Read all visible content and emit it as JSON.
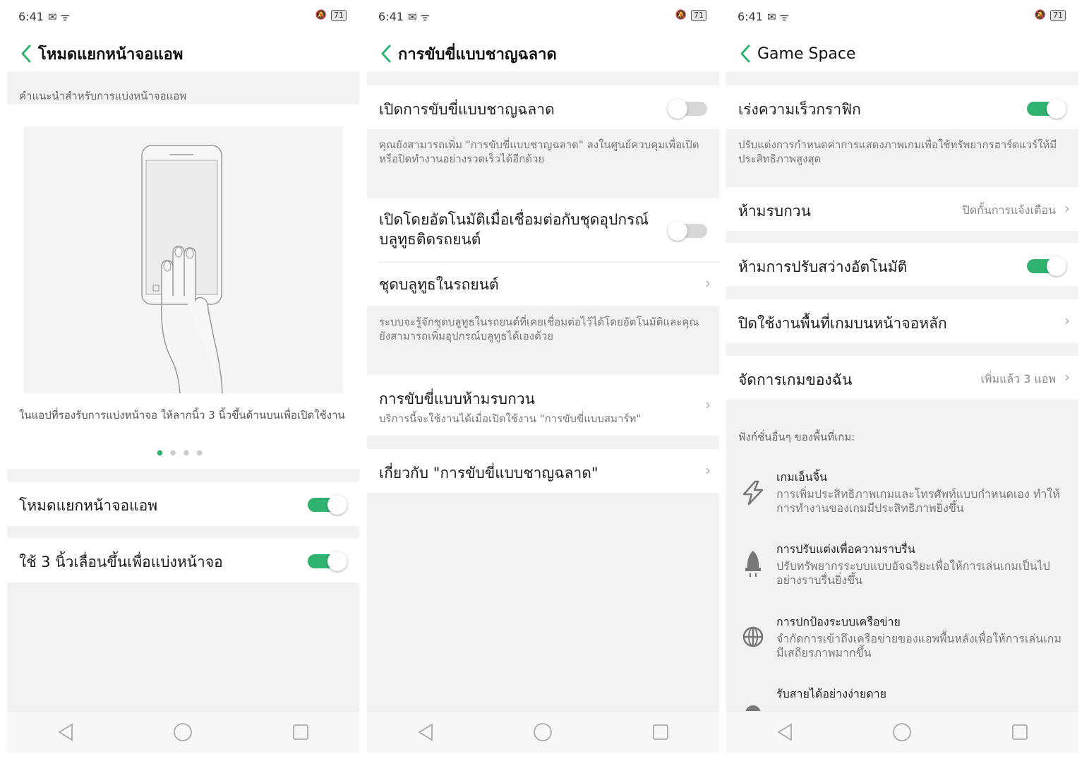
{
  "status_bar": {
    "time": "6:41",
    "battery": "71"
  },
  "screen1": {
    "title": "โหมดแยกหน้าจอแอพ",
    "section_header": "คำแนะนำสำหรับการแบ่งหน้าจอแอพ",
    "illustration_caption": "ในแอปที่รองรับการแบ่งหน้าจอ ให้ลากนิ้ว 3 นิ้วขึ้นด้านบนเพื่อเปิดใช้งาน",
    "page_count": 4,
    "active_page": 1,
    "rows": [
      {
        "label": "โหมดแยกหน้าจอแอพ",
        "toggle": "on"
      },
      {
        "label": "ใช้ 3 นิ้วเลื่อนขึ้นเพื่อแบ่งหน้าจอ",
        "toggle": "on"
      }
    ]
  },
  "screen2": {
    "title": "การขับขี่แบบชาญฉลาด",
    "enable_label": "เปิดการขับขี่แบบชาญฉลาด",
    "enable_toggle": "off",
    "enable_desc": "คุณยังสามารถเพิ่ม \"การขับขี่แบบชาญฉลาด\" ลงในศูนย์ควบคุมเพื่อเปิดหรือปิดทำงานอย่างรวดเร็วได้อีกด้วย",
    "auto_label": "เปิดโดยอัตโนมัติเมื่อเชื่อมต่อกับชุดอุปกรณ์บลูทูธติดรถยนต์",
    "auto_toggle": "off",
    "car_bt_label": "ชุดบลูทูธในรถยนต์",
    "car_bt_desc": "ระบบจะรู้จักชุดบลูทูธในรถยนต์ที่เคยเชื่อมต่อไว้ได้โดยอัตโนมัติและคุณยังสามารถเพิ่มอุปกรณ์บลูทูธได้เองด้วย",
    "dnd_label": "การขับขี่แบบห้ามรบกวน",
    "dnd_sub": "บริการนี้จะใช้งานได้เมื่อเปิดใช้งาน \"การขับขี่แบบสมาร์ท\"",
    "about_label": "เกี่ยวกับ \"การขับขี่แบบชาญฉลาด\""
  },
  "screen3": {
    "title": "Game Space",
    "graphics_label": "เร่งความเร็วกราฟิก",
    "graphics_toggle": "on",
    "graphics_desc": "ปรับแต่งการกำหนดค่าการแสดงภาพเกมเพื่อใช้ทรัพยากรฮาร์ดแวร์ให้มีประสิทธิภาพสูงสุด",
    "dnd_label": "ห้ามรบกวน",
    "dnd_value": "ปิดกั้นการแจ้งเตือน",
    "brightness_label": "ห้ามการปรับสว่างอัตโนมัติ",
    "brightness_toggle": "on",
    "homescreen_label": "ปิดใช้งานพื้นที่เกมบนหน้าจอหลัก",
    "manage_label": "จัดการเกมของฉัน",
    "manage_value": "เพิ่มแล้ว 3 แอพ",
    "other_header": "ฟังก์ชั่นอื่นๆ ของพื้นที่เกม:",
    "features": [
      {
        "icon": "lightning-icon",
        "title": "เกมเอ็นจิ้น",
        "desc": "การเพิ่มประสิทธิภาพเกมและโทรศัพท์แบบกำหนดเอง ทำให้การทำงานของเกมมีประสิทธิภาพยิ่งขึ้น"
      },
      {
        "icon": "rocket-icon",
        "title": "การปรับแต่งเพื่อความราบรื่น",
        "desc": "ปรับทรัพยากรระบบแบบอัจฉริยะเพื่อให้การเล่นเกมเป็นไปอย่างราบรื่นยิ่งขึ้น"
      },
      {
        "icon": "globe-icon",
        "title": "การปกป้องระบบเครือข่าย",
        "desc": "จำกัดการเข้าถึงเครือข่ายของแอพพื้นหลังเพื่อให้การเล่นเกมมีเสถียรภาพมากขึ้น"
      },
      {
        "icon": "phone-icon",
        "title": "รับสายได้อย่างง่ายดาย",
        "desc": ""
      }
    ]
  },
  "colors": {
    "accent": "#2fb36e",
    "toggle_off": "#d7d7d7",
    "background": "#f2f2f2"
  }
}
